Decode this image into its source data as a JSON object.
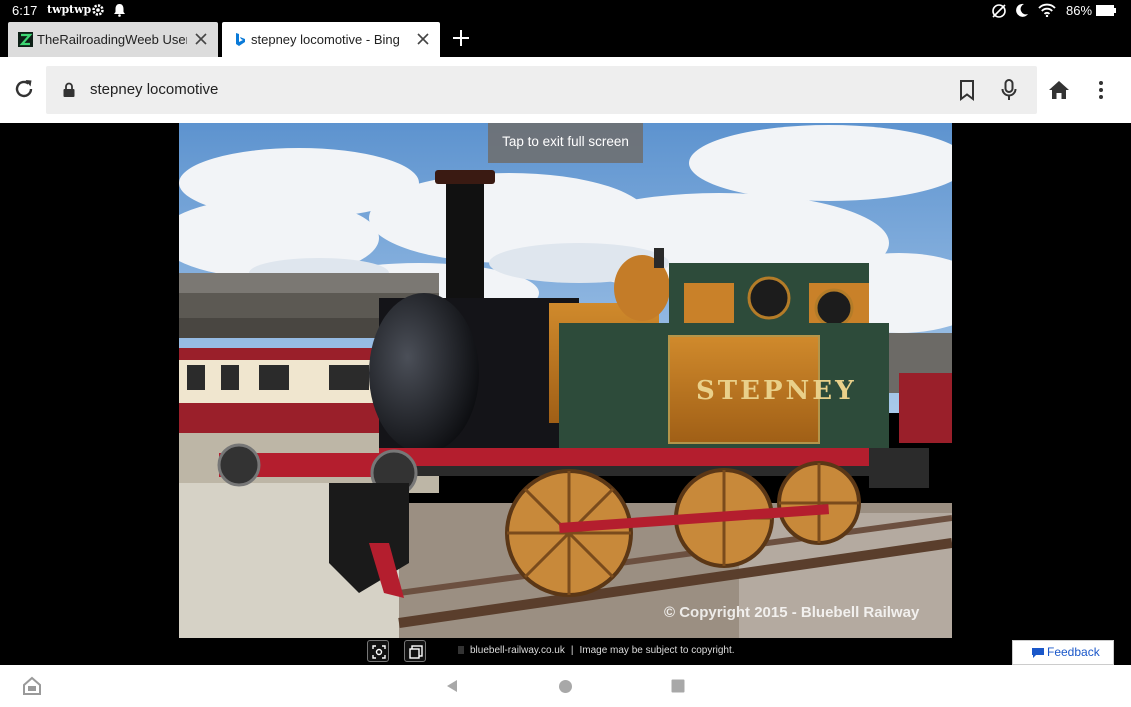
{
  "status_bar": {
    "time": "6:17",
    "notification_labels": [
      "twp",
      "twp"
    ],
    "battery": "86%"
  },
  "tabs": [
    {
      "title": "TheRailroadingWeeb User Pr",
      "favicon": "green-z-favicon",
      "active": false
    },
    {
      "title": "stepney locomotive - Bing im",
      "favicon": "bing-favicon",
      "active": true
    }
  ],
  "omnibox": {
    "url": "stepney locomotive"
  },
  "viewer": {
    "exit_toast": "Tap to exit full screen",
    "image_watermark": "© Copyright 2015 - Bluebell Railway",
    "source_domain": "bluebell-railway.co.uk",
    "separator": "|",
    "copyright_notice": "Image may be subject to copyright.",
    "feedback_label": "Feedback"
  },
  "colors": {
    "accent_blue": "#1a57c9",
    "tab_active": "#ffffff",
    "tab_inactive": "#dcdcdc",
    "omnibox_bg": "#eeeeee"
  }
}
